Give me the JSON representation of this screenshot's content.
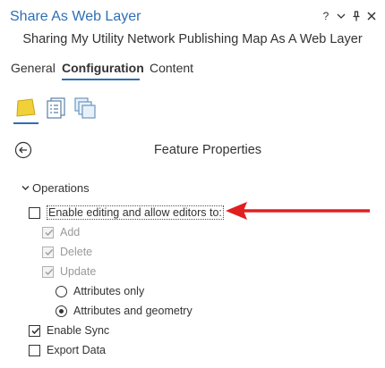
{
  "window": {
    "title": "Share As Web Layer",
    "controls": [
      "?",
      "⌄",
      "⊥",
      "×"
    ]
  },
  "subtitle": "Sharing My Utility Network Publishing Map As A Web Layer",
  "tabs": [
    {
      "label": "General",
      "active": false
    },
    {
      "label": "Configuration",
      "active": true
    },
    {
      "label": "Content",
      "active": false
    }
  ],
  "icons": [
    "layers-icon",
    "properties-list-icon",
    "stacked-pages-icon"
  ],
  "section_title": "Feature Properties",
  "operations": {
    "header": "Operations",
    "enable_editing": {
      "label": "Enable editing and allow editors to:",
      "checked": false
    },
    "add": {
      "label": "Add",
      "checked": true,
      "disabled": true
    },
    "delete": {
      "label": "Delete",
      "checked": true,
      "disabled": true
    },
    "update": {
      "label": "Update",
      "checked": true,
      "disabled": true
    },
    "attributes_only": {
      "label": "Attributes only",
      "selected": false
    },
    "attributes_geometry": {
      "label": "Attributes and geometry",
      "selected": true
    },
    "enable_sync": {
      "label": "Enable Sync",
      "checked": true
    },
    "export_data": {
      "label": "Export Data",
      "checked": false
    }
  },
  "colors": {
    "accent": "#2d6fb5",
    "annotation_arrow": "#e02020"
  }
}
